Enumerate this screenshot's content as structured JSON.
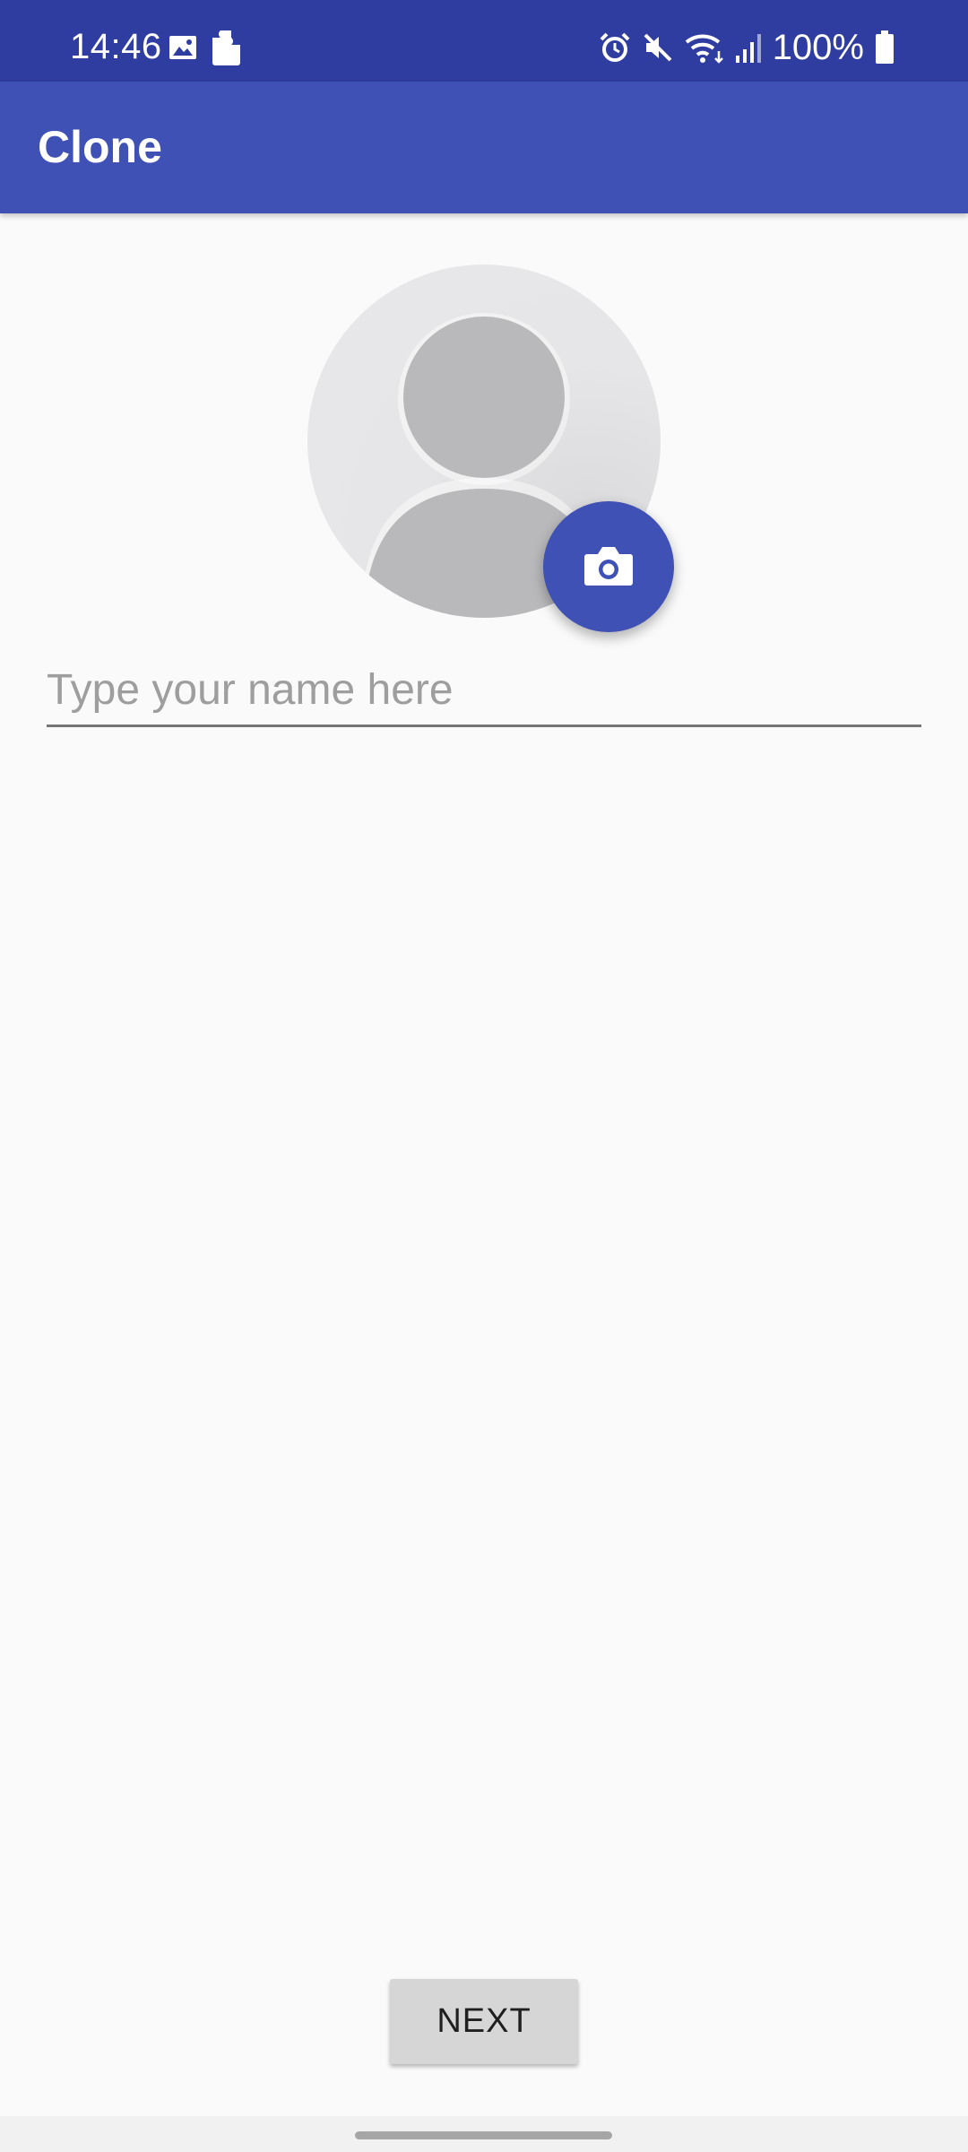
{
  "status_bar": {
    "time": "14:46",
    "battery_text": "100%",
    "left_icons": [
      "image-icon",
      "puzzle-icon"
    ],
    "right_icons": [
      "alarm-icon",
      "mute-icon",
      "wifi-icon",
      "signal-icon",
      "battery-icon"
    ]
  },
  "app_bar": {
    "title": "Clone"
  },
  "profile": {
    "avatar_icon": "person-placeholder-icon",
    "camera_button_icon": "camera-icon"
  },
  "name_field": {
    "value": "",
    "placeholder": "Type your name here"
  },
  "actions": {
    "next_label": "NEXT"
  },
  "colors": {
    "status_bar": "#2f3da0",
    "app_bar": "#3f51b5",
    "fab": "#3f51b5",
    "background": "#fafafa",
    "button": "#d6d6d6"
  }
}
